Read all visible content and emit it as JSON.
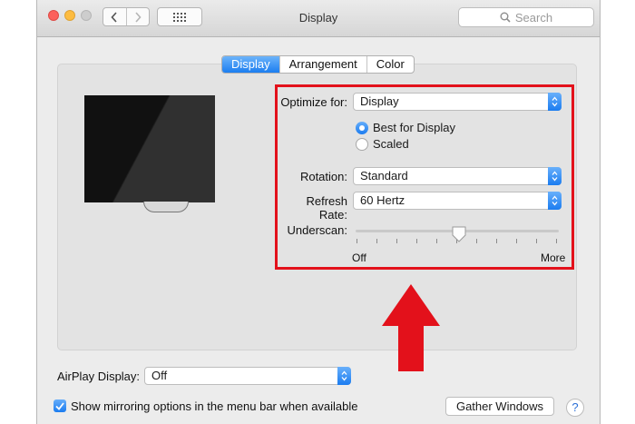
{
  "window": {
    "title": "Display"
  },
  "toolbar": {
    "search_placeholder": "Search"
  },
  "tabs": [
    {
      "label": "Display",
      "active": true
    },
    {
      "label": "Arrangement",
      "active": false
    },
    {
      "label": "Color",
      "active": false
    }
  ],
  "settings": {
    "optimize_label": "Optimize for:",
    "optimize_value": "Display",
    "radio_best": "Best for Display",
    "radio_scaled": "Scaled",
    "selected_option": "Best for Display",
    "rotation_label": "Rotation:",
    "rotation_value": "Standard",
    "refresh_label": "Refresh Rate:",
    "refresh_value": "60 Hertz",
    "underscan_label": "Underscan:",
    "underscan_min": "Off",
    "underscan_max": "More",
    "underscan_level_percent": 50
  },
  "footer": {
    "airplay_label": "AirPlay Display:",
    "airplay_value": "Off",
    "mirroring_label": "Show mirroring options in the menu bar when available",
    "mirroring_checked": true,
    "gather_button": "Gather Windows",
    "help_glyph": "?"
  },
  "colors": {
    "accent": "#1c7ef0",
    "highlight_border": "#e3111b",
    "arrow": "#e3111b"
  }
}
